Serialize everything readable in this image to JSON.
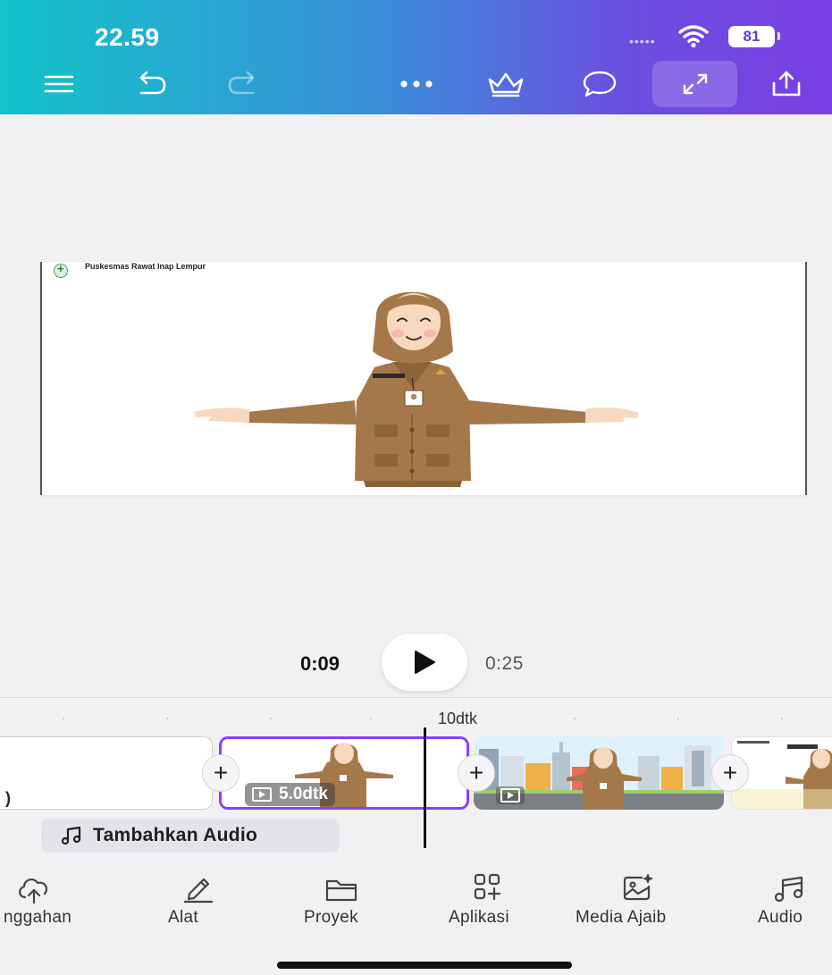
{
  "status_bar": {
    "time": "22.59",
    "battery": "81"
  },
  "header": {
    "icons": [
      "menu-icon",
      "undo-icon",
      "redo-icon",
      "more-icon",
      "crown-icon",
      "comment-icon",
      "expand-icon",
      "share-icon"
    ]
  },
  "preview": {
    "title": "Puskesmas Rawat Inap Lempur"
  },
  "playback": {
    "current_time": "0:09",
    "total_time": "0:25"
  },
  "timeline": {
    "ruler_label": "10dtk",
    "selected_clip_duration": "5.0dtk",
    "partial_char": ")",
    "add_audio_label": "Tambahkan Audio"
  },
  "bottom_nav": {
    "items": [
      {
        "label": "nggahan",
        "icon": "cloud-upload-icon"
      },
      {
        "label": "Alat",
        "icon": "pen-icon"
      },
      {
        "label": "Proyek",
        "icon": "folder-icon"
      },
      {
        "label": "Aplikasi",
        "icon": "apps-icon"
      },
      {
        "label": "Media Ajaib",
        "icon": "magic-media-icon"
      },
      {
        "label": "Audio",
        "icon": "music-icon"
      }
    ]
  },
  "colors": {
    "accent": "#8b3dff",
    "header_start": "#13c4c9",
    "header_end": "#7a3fe4"
  }
}
